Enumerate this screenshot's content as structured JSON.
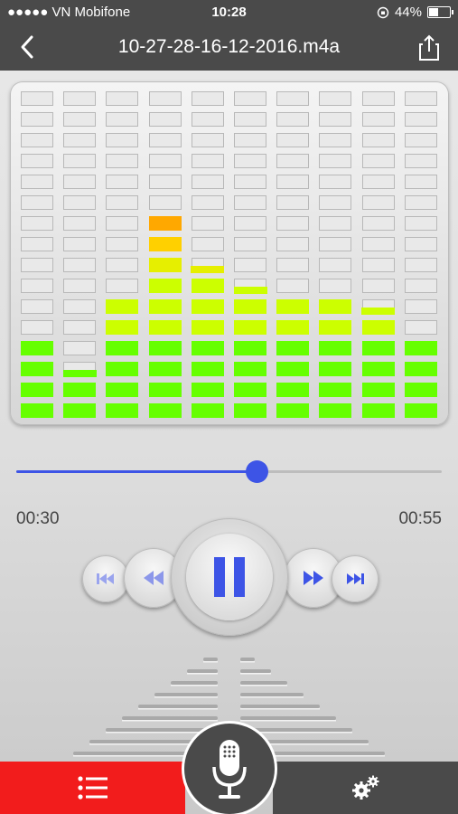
{
  "status_bar": {
    "carrier": "●●●●● VN Mobifone",
    "time": "10:28",
    "battery": "44%",
    "battery_level": 0.44
  },
  "nav": {
    "title": "10-27-28-16-12-2016.m4a",
    "back_icon": "chevron-left-icon",
    "share_icon": "share-icon"
  },
  "equalizer": {
    "columns": 10,
    "rows": 16,
    "levels": [
      4,
      2.5,
      6,
      10,
      7.5,
      6.5,
      6,
      6,
      5.5,
      4
    ],
    "colors": {
      "green": "#66ff00",
      "lime": "#ccff00",
      "yellow": "#ffd000",
      "orange": "#ffa800"
    }
  },
  "player": {
    "elapsed": "00:30",
    "duration": "00:55",
    "progress": 0.565,
    "state": "playing",
    "accent": "#3d54e6"
  },
  "controls": {
    "skip_back": "skip-back-icon",
    "rewind": "rewind-icon",
    "pause": "pause-icon",
    "fast_forward": "fast-forward-icon",
    "skip_forward": "skip-forward-icon"
  },
  "tabs": {
    "list": "list-icon",
    "record": "microphone-icon",
    "settings": "gears-icon",
    "active_color": "#f21c1c",
    "bar_color": "#4a4a4a"
  }
}
